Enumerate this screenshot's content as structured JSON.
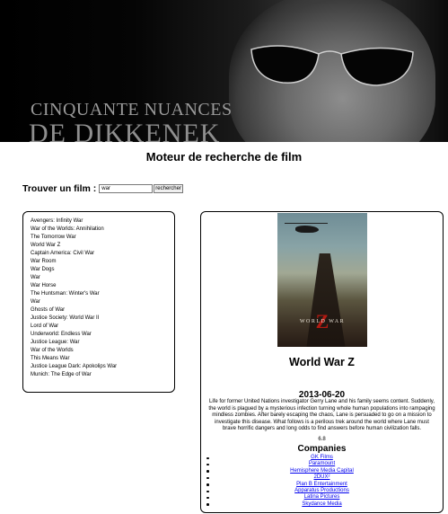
{
  "banner": {
    "logo_line1": "CINQUANTE NUANCES",
    "logo_line2": "DE DIKKENEK"
  },
  "page_title": "Moteur de recherche de film",
  "search": {
    "label": "Trouver un film :",
    "value": "war",
    "button_label": "rechercher"
  },
  "results": [
    "Avengers: Infinity War",
    "War of the Worlds: Annihilation",
    "The Tomorrow War",
    "World War Z",
    "Captain America: Civil War",
    "War Room",
    "War Dogs",
    "War",
    "War Horse",
    "The Huntsman: Winter's War",
    "War",
    "Ghosts of War",
    "Justice Society: World War II",
    "Lord of War",
    "Underworld: Endless War",
    "Justice League: War",
    "War of the Worlds",
    "This Means War",
    "Justice League Dark: Apokolips War",
    "Munich: The Edge of War"
  ],
  "movie": {
    "poster_title": "WORLD WAR",
    "poster_z": "Z",
    "title": "World War Z",
    "release_date": "2013-06-20",
    "overview": "Life for former United Nations investigator Gerry Lane and his family seems content. Suddenly, the world is plagued by a mysterious infection turning whole human populations into rampaging mindless zombies. After barely escaping the chaos, Lane is persuaded to go on a mission to investigate this disease. What follows is a perilous trek around the world where Lane must brave horrific dangers and long odds to find answers before human civilization falls.",
    "rating": "6.8",
    "companies_title": "Companies",
    "companies": [
      "GK Films",
      "Paramount",
      "Hemisphere Media Capital",
      "2DUX²",
      "Plan B Entertainment",
      "Apparatus Productions",
      "Latina Pictures",
      "Skydance Media"
    ]
  }
}
